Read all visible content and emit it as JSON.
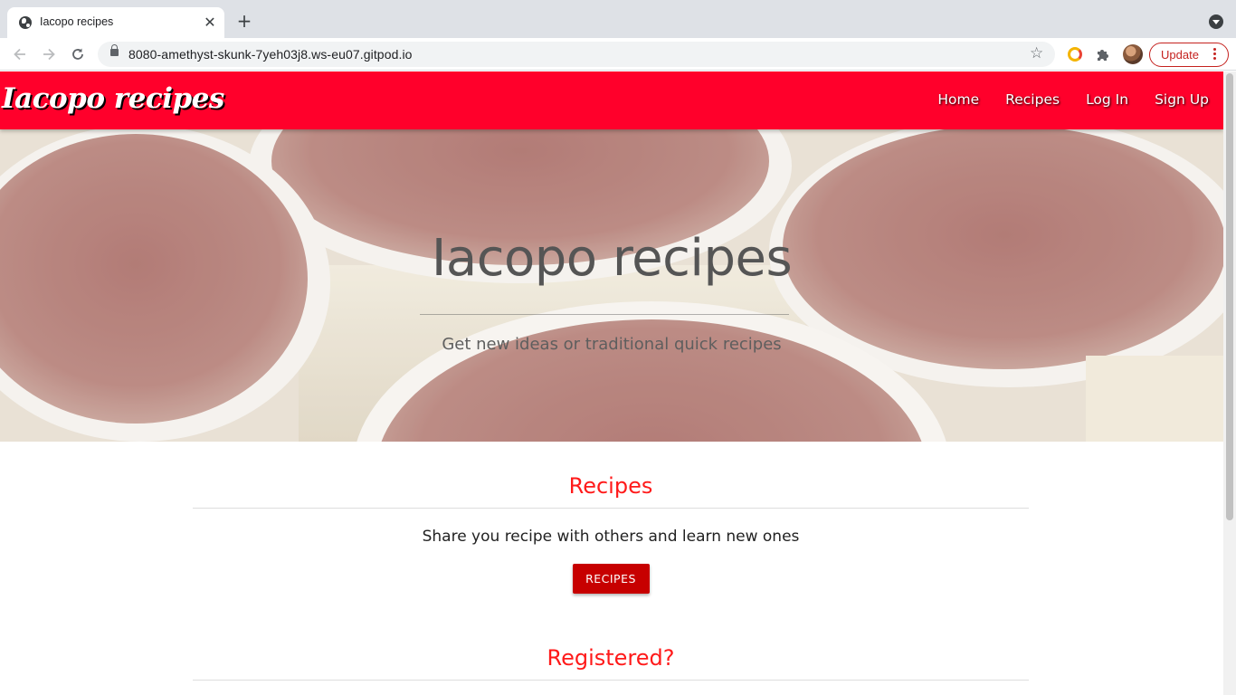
{
  "browser": {
    "tab_title": "Iacopo recipes",
    "tab_close_glyph": "✕",
    "new_tab_glyph": "+",
    "url": "8080-amethyst-skunk-7yeh03j8.ws-eu07.gitpod.io",
    "star_glyph": "☆",
    "update_label": "Update",
    "icons": [
      "globe-icon",
      "close-icon",
      "plus-icon",
      "tab-search-icon",
      "back-arrow-icon",
      "forward-arrow-icon",
      "reload-icon",
      "lock-icon",
      "star-icon",
      "grammarly-extension-icon",
      "extensions-puzzle-icon",
      "profile-avatar",
      "more-vert-icon"
    ]
  },
  "site": {
    "brand": "Iacopo recipes",
    "nav": [
      "Home",
      "Recipes",
      "Log In",
      "Sign Up"
    ],
    "accent_color": "#ff002b",
    "heading_color": "#ff1a1a",
    "button_color": "#c70000"
  },
  "hero": {
    "title": "Iacopo recipes",
    "subtitle": "Get new ideas or traditional quick recipes",
    "background": "tiramisu cups dusted with cocoa"
  },
  "sections": [
    {
      "title": "Recipes",
      "text": "Share you recipe with others and learn new ones",
      "button": "RECIPES"
    },
    {
      "title": "Registered?"
    }
  ]
}
